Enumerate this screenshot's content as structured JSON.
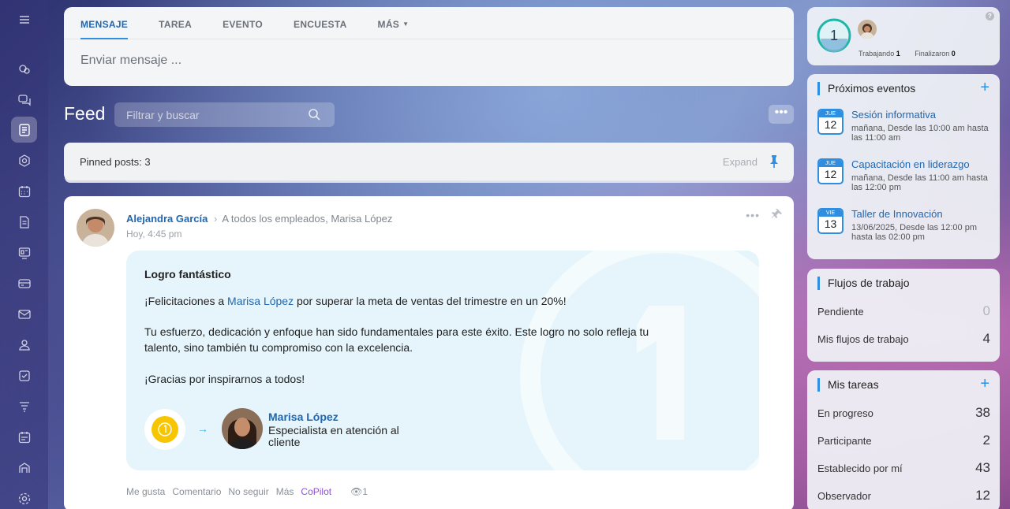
{
  "composer": {
    "tabs": [
      "MENSAJE",
      "TAREA",
      "EVENTO",
      "ENCUESTA",
      "MÁS"
    ],
    "placeholder": "Enviar mensaje ..."
  },
  "feed": {
    "title": "Feed",
    "search_placeholder": "Filtrar y buscar"
  },
  "pinned": {
    "label": "Pinned posts: 3",
    "expand": "Expand"
  },
  "post": {
    "author": "Alejandra García",
    "recipients": "A todos los empleados, Marisa López",
    "time": "Hoy, 4:45 pm",
    "kudos": {
      "title": "Logro fantástico",
      "p1_before": "¡Felicitaciones a ",
      "p1_link": "Marisa López",
      "p1_after": " por superar la meta de ventas del trimestre en un 20%!",
      "p2": "Tu esfuerzo, dedicación y enfoque han sido fundamentales para este éxito. Este logro no solo refleja tu talento, sino también tu compromiso con la excelencia.",
      "p3": "¡Gracias por inspirarnos a todos!",
      "recipient_name": "Marisa López",
      "recipient_role": "Especialista en atención al cliente"
    },
    "actions": {
      "like": "Me gusta",
      "comment": "Comentario",
      "unfollow": "No seguir",
      "more": "Más",
      "copilot": "CoPilot",
      "views": "1"
    }
  },
  "time_widget": {
    "count": "1",
    "working_label": "Trabajando",
    "working_value": "1",
    "finished_label": "Finalizaron",
    "finished_value": "0"
  },
  "events": {
    "title": "Próximos eventos",
    "items": [
      {
        "day": "JUE",
        "num": "12",
        "title": "Sesión informativa",
        "sub": "mañana, Desde las 10:00 am hasta las 11:00 am"
      },
      {
        "day": "JUE",
        "num": "12",
        "title": "Capacitación en liderazgo",
        "sub": "mañana, Desde las 11:00 am hasta las 12:00 pm"
      },
      {
        "day": "VIE",
        "num": "13",
        "title": "Taller de Innovación",
        "sub": "13/06/2025, Desde las 12:00 pm hasta las 02:00 pm"
      }
    ]
  },
  "workflows": {
    "title": "Flujos de trabajo",
    "rows": [
      {
        "label": "Pendiente",
        "value": "0"
      },
      {
        "label": "Mis flujos de trabajo",
        "value": "4"
      }
    ]
  },
  "tasks": {
    "title": "Mis tareas",
    "rows": [
      {
        "label": "En progreso",
        "value": "38"
      },
      {
        "label": "Participante",
        "value": "2"
      },
      {
        "label": "Establecido por mí",
        "value": "43"
      },
      {
        "label": "Observador",
        "value": "12"
      }
    ]
  }
}
